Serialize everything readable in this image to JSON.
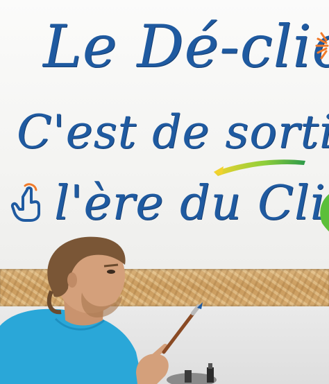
{
  "sign": {
    "line1": "Le Dé-clic",
    "line2": "C'est de sortir de",
    "line3": "l'ère du Clic"
  },
  "colors": {
    "ink": "#1f5aa0",
    "underline_green": "#5bbf3a",
    "underline_yellow": "#f2d22e",
    "orange_accent": "#f07a2a",
    "shirt": "#2aa7d8",
    "plywood": "#d2a76a",
    "wall": "#f6f6f4"
  },
  "icons": [
    "hand-pointer-icon",
    "sun-icon",
    "leaf-icon"
  ]
}
